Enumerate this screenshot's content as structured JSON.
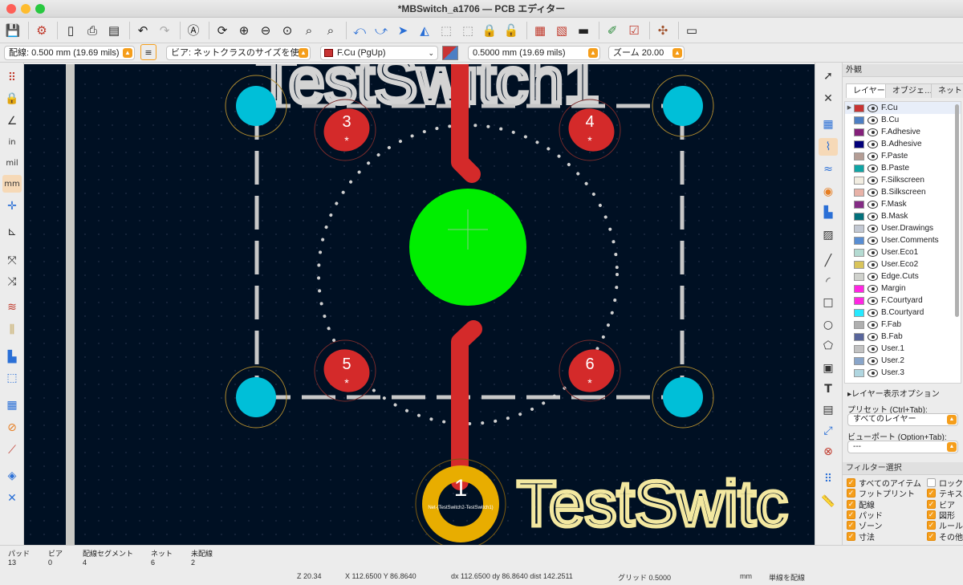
{
  "window": {
    "title": "*MBSwitch_a1706 — PCB エディター"
  },
  "toolbar": {
    "icons": [
      "save-icon",
      "board-setup-icon",
      "page-setup-icon",
      "print-icon",
      "plot-icon",
      "undo-icon",
      "redo-icon",
      "find-icon",
      "redraw-icon",
      "zoom-in-icon",
      "zoom-out-icon",
      "zoom-fit-icon",
      "zoom-objects-icon",
      "zoom-selection-icon",
      "flip-board-icon",
      "rotate-ccw-icon",
      "rotate-cw-icon",
      "mirror-h-icon",
      "mirror-v-icon",
      "group-icon",
      "ungroup-icon",
      "lock-icon",
      "unlock-icon",
      "update-pcb-icon",
      "drc-icon",
      "footprint-editor-icon",
      "footprint-browser-icon",
      "netlist-icon",
      "scripting-icon",
      "scripting-console-icon"
    ]
  },
  "options": {
    "track": "配線: 0.500 mm (19.69 mils)",
    "via": "ビア: ネットクラスのサイズを使用",
    "layer": "F.Cu (PgUp)",
    "grid": "0.5000 mm (19.69 mils)",
    "zoom": "ズーム 20.00"
  },
  "board": {
    "silk_top": "TestSwitch1",
    "silk_bottom": "TestSwitc",
    "pads": [
      "3",
      "4",
      "5",
      "6",
      "1"
    ],
    "pad_marks": [
      "*",
      "*",
      "*",
      "*"
    ],
    "net_label": "Net-(TestSwitch2-TestSwitch1)"
  },
  "panel": {
    "title": "外観",
    "tabs": [
      "レイヤー",
      "オブジェ…",
      "ネット"
    ],
    "layers": [
      {
        "name": "F.Cu",
        "color": "#c83434"
      },
      {
        "name": "B.Cu",
        "color": "#4d7fc4"
      },
      {
        "name": "F.Adhesive",
        "color": "#84207a"
      },
      {
        "name": "B.Adhesive",
        "color": "#02007a"
      },
      {
        "name": "F.Paste",
        "color": "#b49d95"
      },
      {
        "name": "B.Paste",
        "color": "#0fa5a5"
      },
      {
        "name": "F.Silkscreen",
        "color": "#f2ede1"
      },
      {
        "name": "B.Silkscreen",
        "color": "#e8b2a7"
      },
      {
        "name": "F.Mask",
        "color": "#842c85"
      },
      {
        "name": "B.Mask",
        "color": "#03707b"
      },
      {
        "name": "User.Drawings",
        "color": "#c2c8d3"
      },
      {
        "name": "User.Comments",
        "color": "#598ed3"
      },
      {
        "name": "User.Eco1",
        "color": "#b4dbd2"
      },
      {
        "name": "User.Eco2",
        "color": "#d9c45a"
      },
      {
        "name": "Edge.Cuts",
        "color": "#d0d2cd"
      },
      {
        "name": "Margin",
        "color": "#ff26e2"
      },
      {
        "name": "F.Courtyard",
        "color": "#ff26e2"
      },
      {
        "name": "B.Courtyard",
        "color": "#26e9ff"
      },
      {
        "name": "F.Fab",
        "color": "#afafaf"
      },
      {
        "name": "B.Fab",
        "color": "#58659b"
      },
      {
        "name": "User.1",
        "color": "#c2c2c2"
      },
      {
        "name": "User.2",
        "color": "#89a5c9"
      },
      {
        "name": "User.3",
        "color": "#b0d6e0"
      }
    ],
    "layer_display_options": "レイヤー表示オプション",
    "preset_label": "プリセット (Ctrl+Tab):",
    "preset_value": "すべてのレイヤー",
    "viewport_label": "ビューポート (Option+Tab):",
    "viewport_value": "---",
    "filter_title": "フィルター選択",
    "filters_left": [
      {
        "label": "すべてのアイテム",
        "checked": true
      },
      {
        "label": "フットプリント",
        "checked": true
      },
      {
        "label": "配線",
        "checked": true
      },
      {
        "label": "パッド",
        "checked": true
      },
      {
        "label": "ゾーン",
        "checked": true
      },
      {
        "label": "寸法",
        "checked": true
      }
    ],
    "filters_right": [
      {
        "label": "ロック",
        "checked": false
      },
      {
        "label": "テキスト",
        "checked": true
      },
      {
        "label": "ビア",
        "checked": true
      },
      {
        "label": "図形",
        "checked": true
      },
      {
        "label": "ルールエリア",
        "checked": true
      },
      {
        "label": "その他",
        "checked": true
      }
    ]
  },
  "status": {
    "items": [
      {
        "label": "パッド",
        "value": "13"
      },
      {
        "label": "ビア",
        "value": "0"
      },
      {
        "label": "配線セグメント",
        "value": "4"
      },
      {
        "label": "ネット",
        "value": "6"
      },
      {
        "label": "未配線",
        "value": "2"
      }
    ],
    "zoom": "Z 20.34",
    "xy": "X 112.6500  Y 86.8640",
    "delta": "dx 112.6500  dy 86.8640  dist 142.2511",
    "grid": "グリッド 0.5000",
    "units": "mm",
    "mode": "単線を配線"
  }
}
